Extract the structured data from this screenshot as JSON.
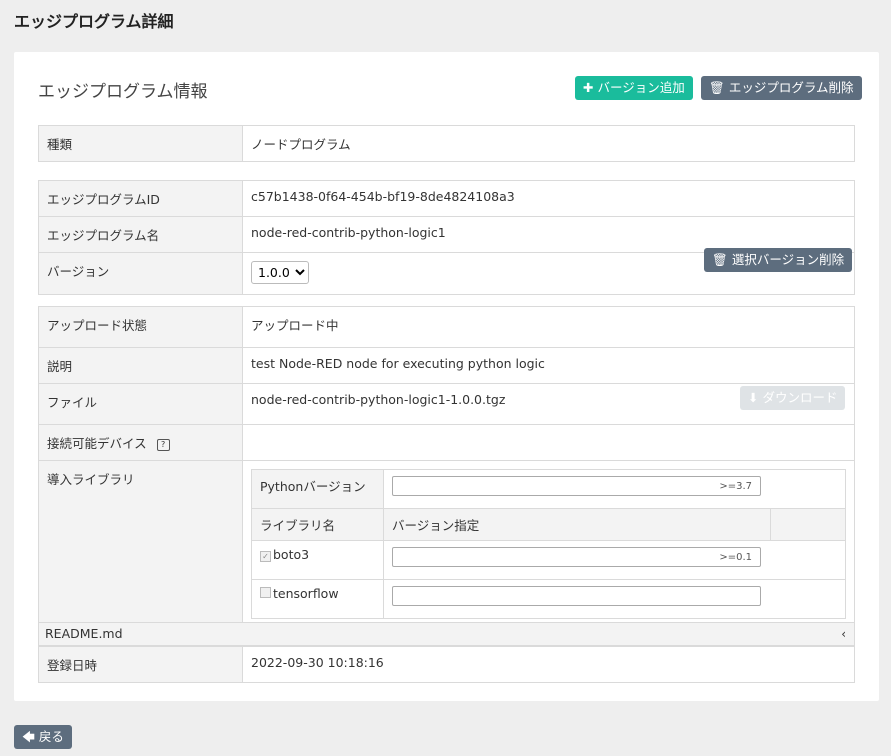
{
  "page": {
    "title": "エッジプログラム詳細",
    "back_label": "戻る"
  },
  "card": {
    "title": "エッジプログラム情報",
    "add_version_label": "バージョン追加",
    "delete_program_label": "エッジプログラム削除"
  },
  "type_row": {
    "label": "種類",
    "value": "ノードプログラム"
  },
  "info": {
    "id_label": "エッジプログラムID",
    "id_value": "c57b1438-0f64-454b-bf19-8de4824108a3",
    "name_label": "エッジプログラム名",
    "name_value": "node-red-contrib-python-logic1",
    "version_label": "バージョン",
    "version_selected": "1.0.0",
    "delete_version_label": "選択バージョン削除"
  },
  "details": {
    "upload_label": "アップロード状態",
    "upload_value": "アップロード中",
    "desc_label": "説明",
    "desc_value": "test Node-RED node for executing python logic",
    "file_label": "ファイル",
    "file_value": "node-red-contrib-python-logic1-1.0.0.tgz",
    "download_label": "ダウンロード",
    "devices_label": "接続可能デバイス",
    "libs_label": "導入ライブラリ",
    "python_version_label": "Pythonバージョン",
    "python_version_value": ">=3.7",
    "col_lib_name": "ライブラリ名",
    "col_version_spec": "バージョン指定",
    "libraries": [
      {
        "name": "boto3",
        "version": ">=0.1",
        "checked": true
      },
      {
        "name": "tensorflow",
        "version": "",
        "checked": false
      }
    ],
    "readme_label": "README.md",
    "registered_label": "登録日時",
    "registered_value": "2022-09-30 10:18:16"
  },
  "colors": {
    "accent": "#1abc9c",
    "secondary": "#5d6d7e",
    "disabled": "#dfe3e6"
  }
}
